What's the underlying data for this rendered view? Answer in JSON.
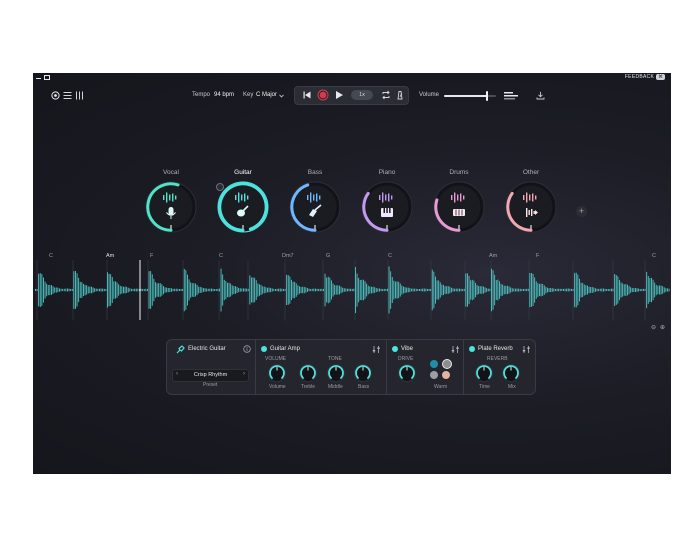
{
  "window": {
    "feedback_label": "FEEDBACK",
    "feedback_badge": "⌘"
  },
  "topbar": {
    "tempo_label": "Tempo",
    "tempo_value": "94 bpm",
    "key_label": "Key",
    "key_value": "C Major",
    "speed_value": "1x",
    "volume_label": "Volume",
    "volume_level": 0.82
  },
  "stems": [
    {
      "label": "Vocal",
      "color": "#4fe3c8",
      "level": 0.55,
      "icon": "microphone-icon"
    },
    {
      "label": "Guitar",
      "color": "#4fe3dd",
      "level": 0.95,
      "icon": "guitar-icon"
    },
    {
      "label": "Bass",
      "color": "#6fb7ff",
      "level": 0.45,
      "icon": "bass-guitar-icon"
    },
    {
      "label": "Piano",
      "color": "#c29bf0",
      "level": 0.35,
      "icon": "piano-icon"
    },
    {
      "label": "Drums",
      "color": "#e79bd6",
      "level": 0.3,
      "icon": "drum-icon"
    },
    {
      "label": "Other",
      "color": "#f2a8b1",
      "level": 0.35,
      "icon": "waveform-icon"
    }
  ],
  "chords": [
    "C",
    "Am",
    "F",
    "C",
    "Dm7",
    "G",
    "C",
    "Am",
    "F",
    "C"
  ],
  "waveform_color": "#4fc9c6",
  "instrument": {
    "name": "Electric Guitar",
    "preset_value": "Crisp Rhythm",
    "preset_label": "Preset"
  },
  "effects": {
    "amp": {
      "title": "Guitar Amp",
      "volume_heading": "VOLUME",
      "tone_heading": "TONE",
      "knobs": [
        "Volume",
        "Treble",
        "Middle",
        "Bass"
      ]
    },
    "vibe": {
      "title": "Vibe",
      "drive_heading": "DRIVE",
      "style_label": "Warm"
    },
    "reverb": {
      "title": "Plate Reverb",
      "reverb_heading": "REVERB",
      "knobs": [
        "Time",
        "Mix"
      ]
    }
  },
  "accent_color": "#4fe3dd"
}
